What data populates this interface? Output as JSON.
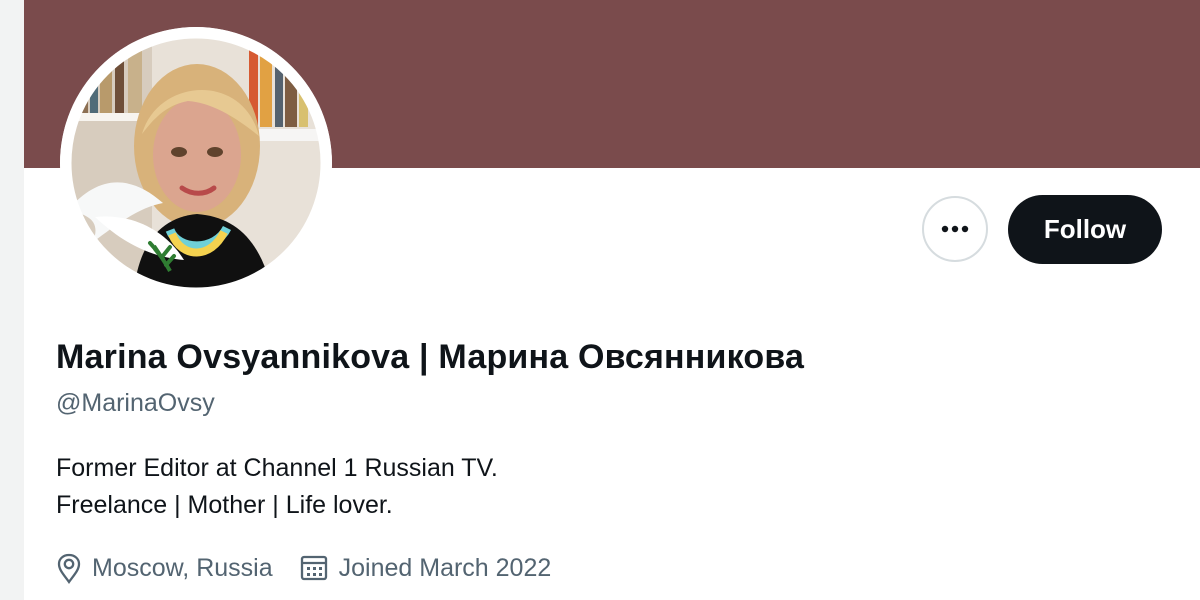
{
  "colors": {
    "banner": "#7a4b4c",
    "follow_bg": "#0f1419",
    "secondary_text": "#536471"
  },
  "profile": {
    "display_name": "Marina Ovsyannikova | Марина Овсянникова",
    "handle": "@MarinaOvsy",
    "bio_line_1": "Former Editor at Channel 1 Russian TV.",
    "bio_line_2": "Freelance | Mother | Life lover.",
    "location": "Moscow, Russia",
    "joined": "Joined March 2022"
  },
  "actions": {
    "more_icon": "ellipsis-icon",
    "follow_label": "Follow"
  },
  "icons": {
    "location": "location-pin-icon",
    "joined": "calendar-icon"
  }
}
